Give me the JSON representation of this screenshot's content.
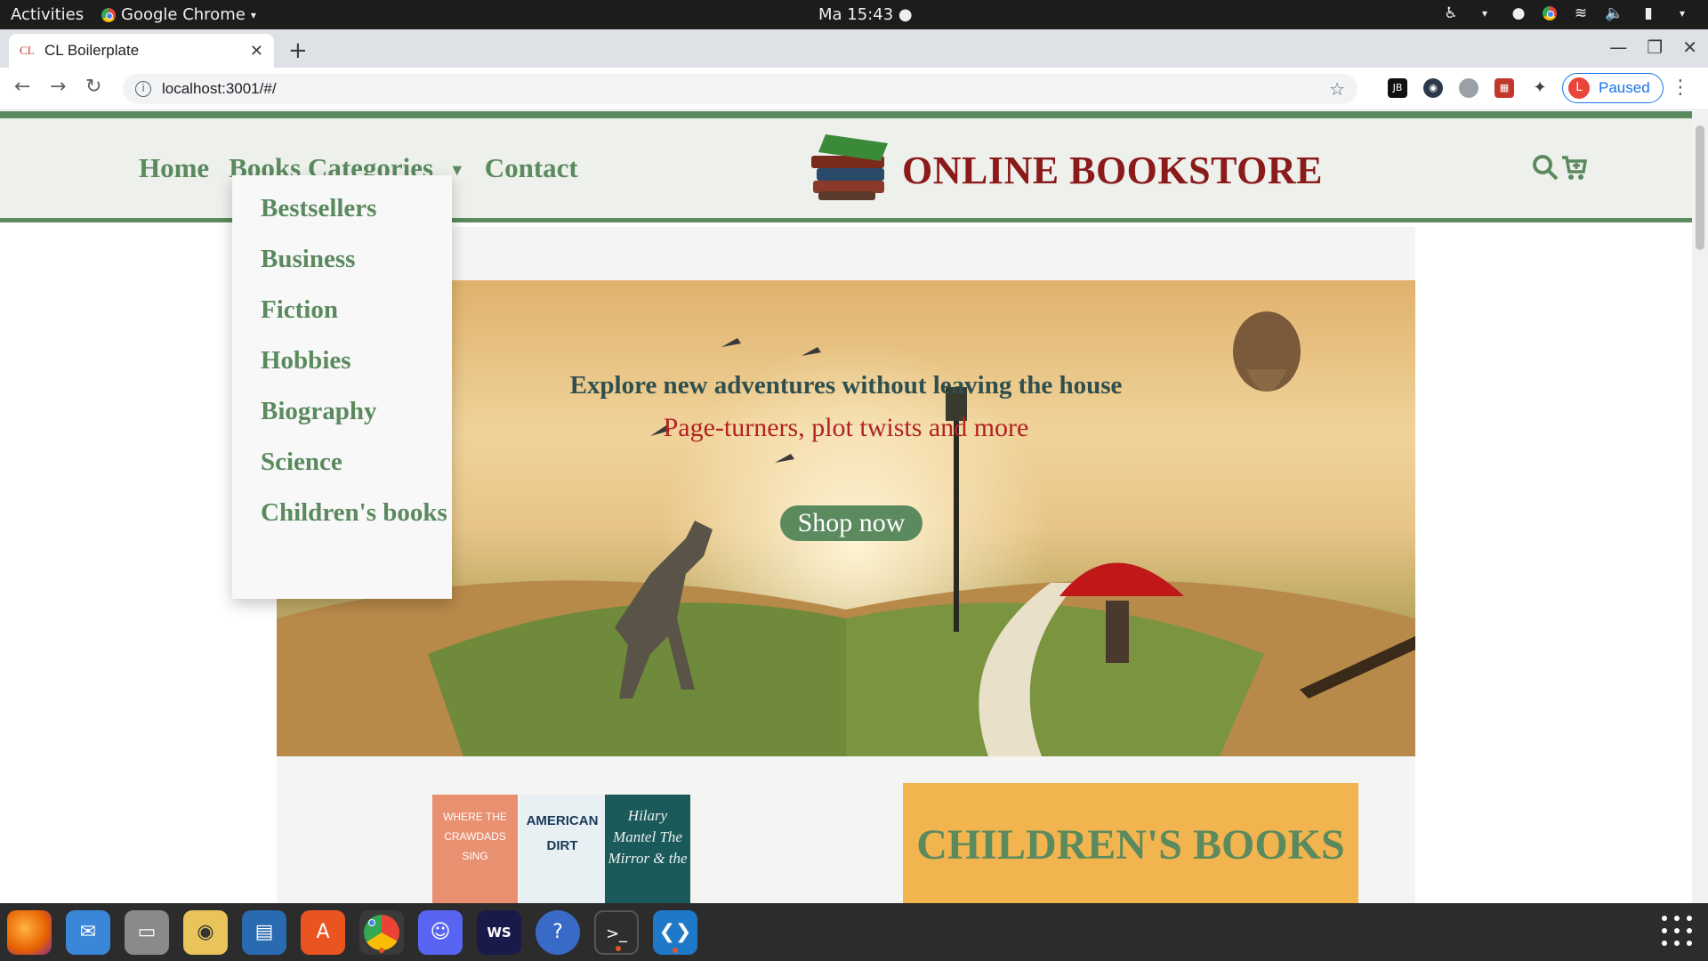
{
  "gnome": {
    "activities": "Activities",
    "app_name": "Google Chrome",
    "clock": "Ma 15:43 ●"
  },
  "browser": {
    "tab_favicon": "CL",
    "tab_title": "CL Boilerplate",
    "url": "localhost:3001/#/",
    "profile_initial": "L",
    "profile_status": "Paused"
  },
  "site": {
    "nav": {
      "home": "Home",
      "categories": "Books Categories",
      "contact": "Contact"
    },
    "brand": "ONLINE BOOKSTORE",
    "dropdown": [
      "Bestsellers",
      "Business",
      "Fiction",
      "Hobbies",
      "Biography",
      "Science",
      "Children's books"
    ],
    "hero": {
      "title": "Explore new adventures without leaving the house",
      "subtitle": "Page-turners, plot twists and more",
      "cta": "Shop now"
    },
    "books": [
      {
        "title": "WHERE THE CRAWDADS SING",
        "color": "#e89070"
      },
      {
        "title": "AMERICAN DIRT",
        "color": "#e8f0f4"
      },
      {
        "title": "Hilary Mantel The Mirror & the",
        "color": "#1a5a5a"
      }
    ],
    "children_card": "CHILDREN'S BOOKS"
  },
  "colors": {
    "accent_green": "#5a8a5e",
    "brand_red": "#8b1a1a",
    "subtitle_red": "#b22222",
    "card_orange": "#f2b44f"
  }
}
